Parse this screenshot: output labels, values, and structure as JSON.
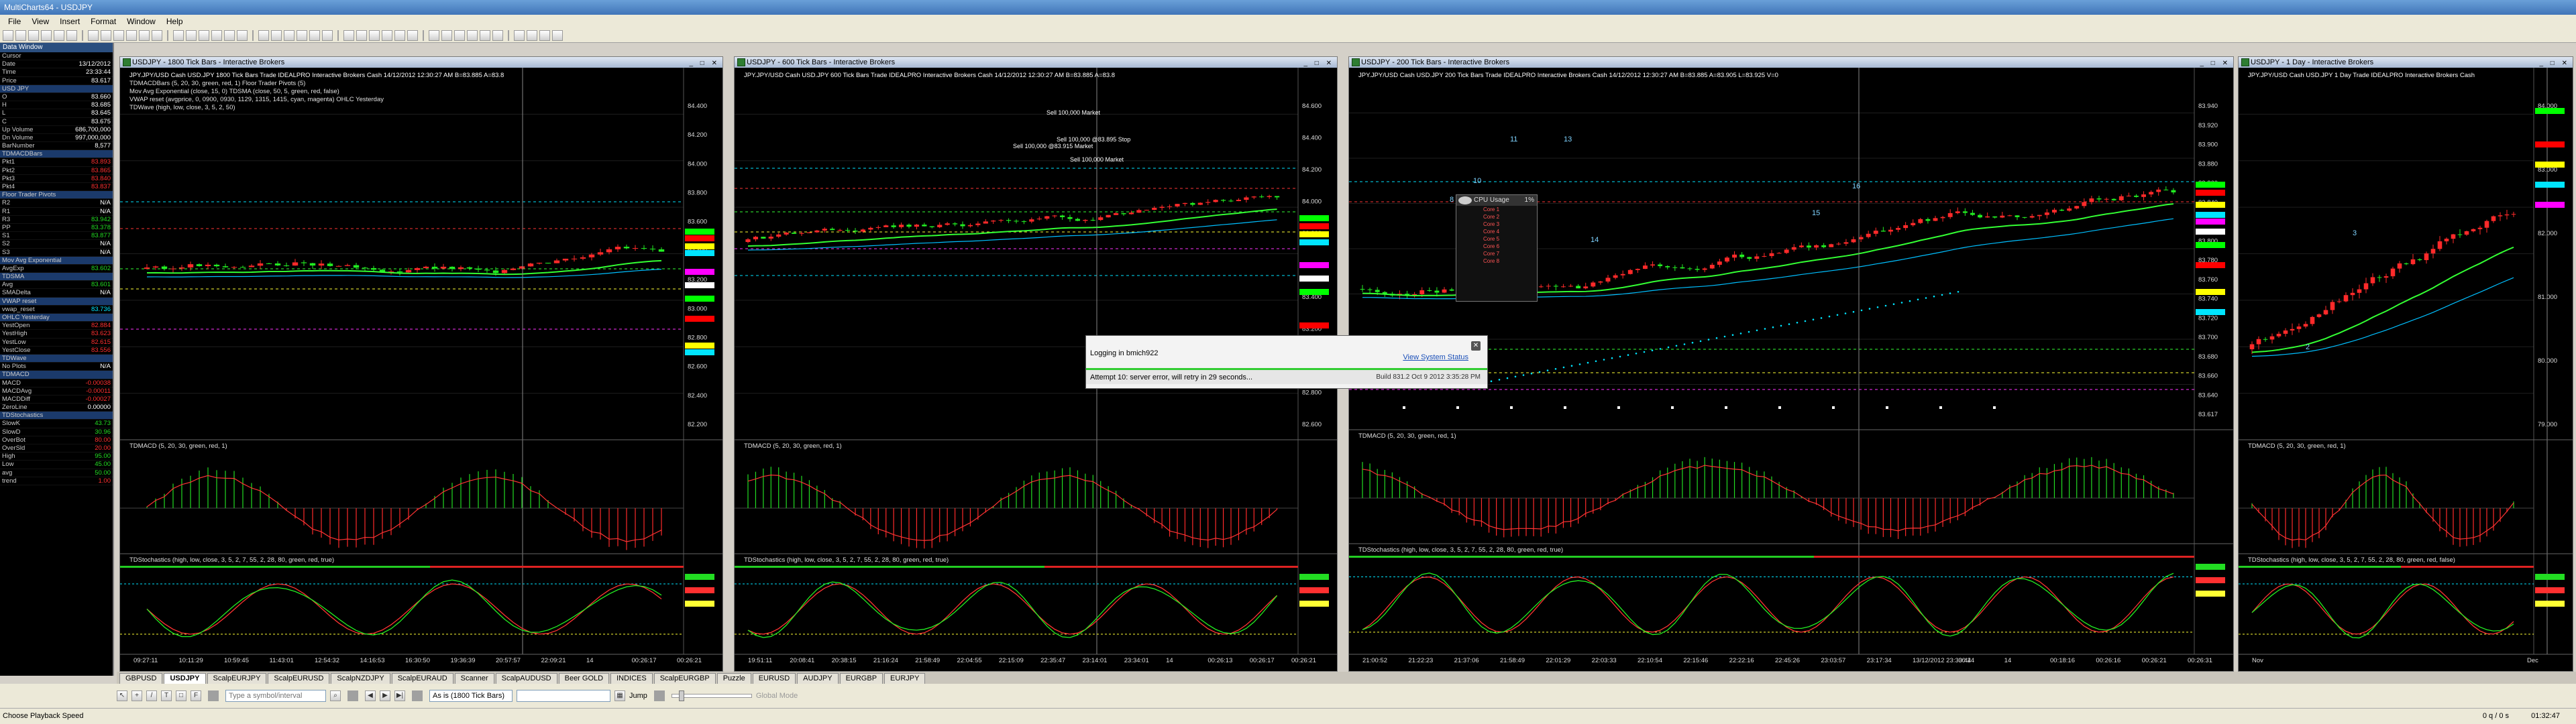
{
  "app": {
    "title": "MultiCharts64 - USDJPY"
  },
  "menu": [
    "File",
    "View",
    "Insert",
    "Format",
    "Window",
    "Help"
  ],
  "data_window": {
    "title": "Data Window",
    "rows": [
      {
        "k": "Cursor",
        "v": ""
      },
      {
        "k": "Date",
        "v": "13/12/2012"
      },
      {
        "k": "Time",
        "v": "23:33:44"
      },
      {
        "k": "Price",
        "v": "83.617"
      },
      {
        "k": "USD JPY",
        "v": "",
        "sec": true
      },
      {
        "k": "O",
        "v": "83.660"
      },
      {
        "k": "H",
        "v": "83.685"
      },
      {
        "k": "L",
        "v": "83.645"
      },
      {
        "k": "C",
        "v": "83.675"
      },
      {
        "k": "Up Volume",
        "v": "686,700,000"
      },
      {
        "k": "Dn Volume",
        "v": "997,000,000"
      },
      {
        "k": "BarNumber",
        "v": "8,577"
      },
      {
        "k": "TDMACDBars",
        "v": "",
        "sec": true
      },
      {
        "k": "Pkt1",
        "v": "83.893",
        "c": "red"
      },
      {
        "k": "Pkt2",
        "v": "83.865",
        "c": "red"
      },
      {
        "k": "Pkt3",
        "v": "83.840",
        "c": "red"
      },
      {
        "k": "Pkt4",
        "v": "83.837",
        "c": "red"
      },
      {
        "k": "Floor Trader Pivots",
        "v": "",
        "sec": true
      },
      {
        "k": "R2",
        "v": "N/A"
      },
      {
        "k": "R1",
        "v": "N/A"
      },
      {
        "k": "R3",
        "v": "83.942",
        "c": "green"
      },
      {
        "k": "PP",
        "v": "83.378",
        "c": "green"
      },
      {
        "k": "S1",
        "v": "83.877",
        "c": "green"
      },
      {
        "k": "S2",
        "v": "N/A"
      },
      {
        "k": "S3",
        "v": "N/A"
      },
      {
        "k": "Mov Avg Exponential",
        "v": "",
        "sec": true
      },
      {
        "k": "AvgExp",
        "v": "83.602",
        "c": "green"
      },
      {
        "k": "TDSMA",
        "v": "",
        "sec": true
      },
      {
        "k": "Avg",
        "v": "83.601",
        "c": "green"
      },
      {
        "k": "SMADelta",
        "v": "N/A"
      },
      {
        "k": "VWAP reset",
        "v": "",
        "sec": true
      },
      {
        "k": "vwap_reset",
        "v": "83.736",
        "c": "cyan"
      },
      {
        "k": "OHLC Yesterday",
        "v": "",
        "sec": true
      },
      {
        "k": "YestOpen",
        "v": "82.884",
        "c": "red"
      },
      {
        "k": "YestHigh",
        "v": "83.623",
        "c": "red"
      },
      {
        "k": "YestLow",
        "v": "82.615",
        "c": "red"
      },
      {
        "k": "YestClose",
        "v": "83.556",
        "c": "red"
      },
      {
        "k": "TDWave",
        "v": "",
        "sec": true
      },
      {
        "k": "No Plots",
        "v": "N/A"
      },
      {
        "k": "TDMACD",
        "v": "",
        "sec": true
      },
      {
        "k": "MACD",
        "v": "-0.00038",
        "c": "red"
      },
      {
        "k": "MACDAvg",
        "v": "-0.00011",
        "c": "red"
      },
      {
        "k": "MACDDiff",
        "v": "-0.00027",
        "c": "red"
      },
      {
        "k": "ZeroLine",
        "v": "0.00000"
      },
      {
        "k": "TDStochastics",
        "v": "",
        "sec": true
      },
      {
        "k": "SlowK",
        "v": "43.73",
        "c": "green"
      },
      {
        "k": "SlowD",
        "v": "30.96",
        "c": "green"
      },
      {
        "k": "OverBot",
        "v": "80.00",
        "c": "red"
      },
      {
        "k": "OverSld",
        "v": "20.00",
        "c": "red"
      },
      {
        "k": "High",
        "v": "95.00",
        "c": "green"
      },
      {
        "k": "Low",
        "v": "45.00",
        "c": "green"
      },
      {
        "k": "avg",
        "v": "50.00",
        "c": "green"
      },
      {
        "k": "trend",
        "v": "1.00",
        "c": "red"
      }
    ]
  },
  "charts": [
    {
      "title": "USDJPY - 1800 Tick Bars - Interactive Brokers",
      "legend1": "JPY.JPY/USD Cash USD.JPY 1800 Tick Bars  Trade IDEALPRO Interactive Brokers Cash 14/12/2012 12:30:27 AM  B=83.885 A=83.8",
      "legend2": "TDMACDBars (5, 20, 30, green, red, 1)   Floor Trader Pivots (5)",
      "legend3": "Mov Avg Exponential (close, 15, 0)   TDSMA (close, 50, 5, green, red, false)",
      "legend4": "VWAP reset (avgprice, 0, 0900, 0930, 1129, 1315, 1415, cyan, magenta)   OHLC Yesterday",
      "legend5": "TDWave (high, low, close, 3, 5, 2, 50)",
      "macd_legend": "TDMACD (5, 20, 30, green, red, 1)",
      "stoch_legend": "TDStochastics (high, low, close, 3, 5, 2, 7, 55, 2, 28, 80, green, red, true)",
      "price_axis": [
        "84.400",
        "84.200",
        "84.000",
        "83.800",
        "83.600",
        "83.400",
        "83.200",
        "83.000",
        "82.800",
        "82.600",
        "82.400",
        "82.200"
      ],
      "time_axis": [
        "09:27:11",
        "10:11:29",
        "10:59:45",
        "11:43:01",
        "12:54:32",
        "14:16:53",
        "16:30:50",
        "19:36:39",
        "20:57:57",
        "22:09:21",
        "14",
        "00:26:17",
        "00:26:21"
      ]
    },
    {
      "title": "USDJPY - 600 Tick Bars - Interactive Brokers",
      "legend1": "JPY.JPY/USD Cash USD.JPY 600 Tick Bars  Trade IDEALPRO Interactive Brokers Cash 14/12/2012 12:30:27 AM  B=83.885 A=83.8",
      "macd_legend": "TDMACD (5, 20, 30, green, red, 1)",
      "stoch_legend": "TDStochastics (high, low, close, 3, 5, 2, 7, 55, 2, 28, 80, green, red, true)",
      "price_axis": [
        "84.600",
        "84.400",
        "84.200",
        "84.000",
        "83.800",
        "83.600",
        "83.400",
        "83.200",
        "83.000",
        "82.800",
        "82.600"
      ],
      "time_axis": [
        "19:51:11",
        "20:08:41",
        "20:38:15",
        "21:16:24",
        "21:58:49",
        "22:04:55",
        "22:15:09",
        "22:35:47",
        "23:14:01",
        "23:34:01",
        "14",
        "00:26:13",
        "00:26:17",
        "00:26:21"
      ],
      "orders": [
        "Sell 100,000 Market",
        "Sell 100,000 @83.895 Stop",
        "Sell 100,000 @83.915 Market",
        "Sell 100,000 Market"
      ]
    },
    {
      "title": "USDJPY - 200 Tick Bars - Interactive Brokers",
      "legend1": "JPY.JPY/USD Cash USD.JPY 200 Tick Bars  Trade IDEALPRO Interactive Brokers Cash 14/12/2012 12:30:27 AM  B=83.885 A=83.905 L=83.925 V=0",
      "macd_legend": "TDMACD (5, 20, 30, green, red, 1)",
      "stoch_legend": "TDStochastics (high, low, close, 3, 5, 2, 7, 55, 2, 28, 80, green, red, true)",
      "price_axis": [
        "83.940",
        "83.920",
        "83.900",
        "83.880",
        "83.860",
        "83.840",
        "83.820",
        "83.800",
        "83.780",
        "83.760",
        "83.740",
        "83.720",
        "83.700",
        "83.680",
        "83.660",
        "83.640",
        "83.617"
      ],
      "time_axis": [
        "21:00:52",
        "21:22:23",
        "21:37:06",
        "21:58:49",
        "22:01:29",
        "22:03:33",
        "22:10:54",
        "22:15:46",
        "22:22:16",
        "22:45:26",
        "23:03:57",
        "23:17:34",
        "13/12/2012 23:33:44",
        "00:24",
        "14",
        "00:18:16",
        "00:26:16",
        "00:26:21",
        "00:26:31"
      ],
      "wave_labels": [
        "8",
        "9",
        "10",
        "11",
        "13",
        "14",
        "15",
        "16"
      ]
    },
    {
      "title": "USDJPY - 1 Day - Interactive Brokers",
      "legend1": "JPY.JPY/USD Cash USD.JPY 1 Day  Trade IDEALPRO Interactive Brokers Cash",
      "macd_legend": "TDMACD (5, 20, 30, green, red, 1)",
      "stoch_legend": "TDStochastics (high, low, close, 3, 5, 2, 7, 55, 2, 28, 80, green, red, false)",
      "price_axis": [
        "84.000",
        "83.000",
        "82.000",
        "81.000",
        "80.000",
        "79.000"
      ],
      "time_axis": [
        "Nov",
        "Dec"
      ],
      "wave_labels": [
        "3",
        "2"
      ]
    }
  ],
  "popup": {
    "line1": "Logging in bmich922",
    "link": "View System Status",
    "status": "Attempt 10: server error, will retry in 29 seconds...",
    "build": "Build 831.2 Oct 9 2012 3:35:28 PM"
  },
  "cpu_widget": {
    "title": "CPU Usage",
    "percent": "1%",
    "cores": [
      "Core 1",
      "Core 2",
      "Core 3",
      "Core 4",
      "Core 5",
      "Core 6",
      "Core 7",
      "Core 8"
    ]
  },
  "tabs": [
    "GBPUSD",
    "USDJPY",
    "ScalpEURJPY",
    "ScalpEURUSD",
    "ScalpNZDJPY",
    "ScalpEURAUD",
    "Scanner",
    "ScalpAUDUSD",
    "Beer GOLD",
    "INDICES",
    "ScalpEURGBP",
    "Puzzle",
    "EURUSD",
    "AUDJPY",
    "EURGBP",
    "EURJPY"
  ],
  "bottombar": {
    "symbol_placeholder": "Type a symbol/interval",
    "bars_combo": "As is (1800 Tick Bars)",
    "jump": "Jump",
    "global_mode": "Global Mode"
  },
  "status": {
    "left": "Choose Playback Speed",
    "right1": "0 q / 0 s",
    "right2": "01:32:47"
  }
}
